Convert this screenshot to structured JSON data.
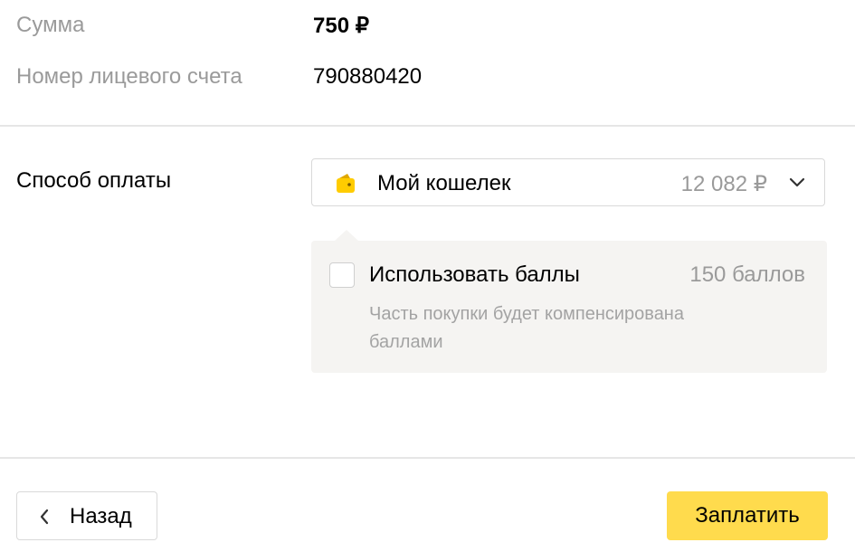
{
  "summary": {
    "amount_label": "Сумма",
    "amount_value": "750 ₽",
    "account_label": "Номер лицевого счета",
    "account_value": "790880420"
  },
  "payment": {
    "label": "Способ оплаты",
    "wallet": {
      "name": "Мой кошелек",
      "balance": "12 082 ₽",
      "icon": "wallet-icon",
      "icon_color": "#ffcc00"
    }
  },
  "points": {
    "checked": false,
    "label": "Использовать баллы",
    "count": "150 баллов",
    "hint": "Часть покупки будет компенсирована баллами"
  },
  "actions": {
    "back_label": "Назад",
    "pay_label": "Заплатить",
    "pay_color": "#ffdb4d"
  }
}
